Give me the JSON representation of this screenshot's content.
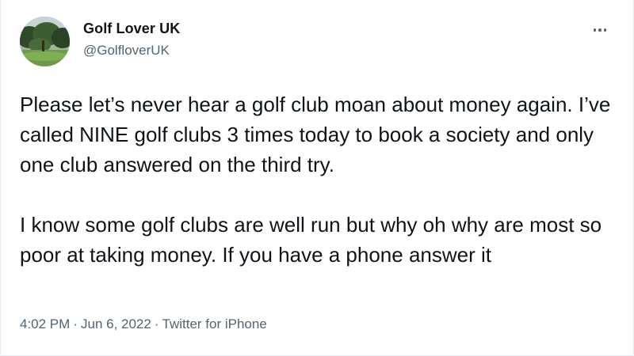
{
  "tweet": {
    "author": {
      "name": "Golf Lover UK",
      "handle": "@GolfloverUK"
    },
    "more_icon": "more-horizontal-icon",
    "text_paragraph_1": "Please let’s never hear a golf club moan about money again. I’ve called NINE golf clubs 3 times today to book a society and only one club answered on the third try.",
    "text_paragraph_2": "I know some golf clubs are well run but why oh why are most so poor at taking money. If you have a phone answer it",
    "time": "4:02 PM",
    "separator": "·",
    "date": "Jun 6, 2022",
    "source": "Twitter for iPhone"
  },
  "colors": {
    "text_primary": "#0f1419",
    "text_secondary": "#536471",
    "border": "#e6ecf0"
  }
}
